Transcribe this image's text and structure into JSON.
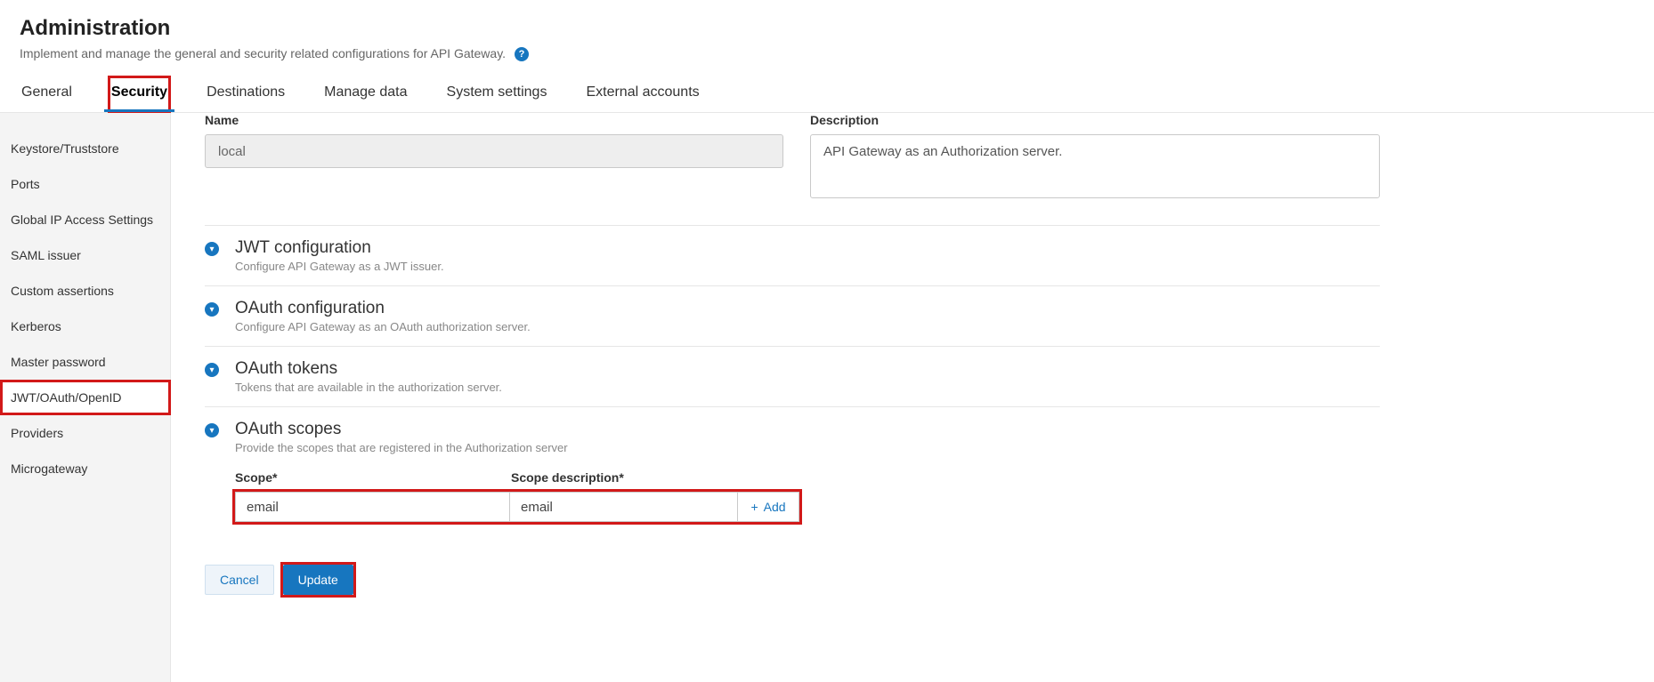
{
  "page": {
    "title": "Administration",
    "subtitle": "Implement and manage the general and security related configurations for API Gateway."
  },
  "tabs": [
    {
      "label": "General",
      "active": false
    },
    {
      "label": "Security",
      "active": true
    },
    {
      "label": "Destinations",
      "active": false
    },
    {
      "label": "Manage data",
      "active": false
    },
    {
      "label": "System settings",
      "active": false
    },
    {
      "label": "External accounts",
      "active": false
    }
  ],
  "sidebar": {
    "items": [
      {
        "label": "Keystore/Truststore",
        "active": false
      },
      {
        "label": "Ports",
        "active": false
      },
      {
        "label": "Global IP Access Settings",
        "active": false
      },
      {
        "label": "SAML issuer",
        "active": false
      },
      {
        "label": "Custom assertions",
        "active": false
      },
      {
        "label": "Kerberos",
        "active": false
      },
      {
        "label": "Master password",
        "active": false
      },
      {
        "label": "JWT/OAuth/OpenID",
        "active": true
      },
      {
        "label": "Providers",
        "active": false
      },
      {
        "label": "Microgateway",
        "active": false
      }
    ]
  },
  "form": {
    "name_label": "Name",
    "name_value": "local",
    "desc_label": "Description",
    "desc_value": "API Gateway as an Authorization server."
  },
  "accordions": [
    {
      "title": "JWT configuration",
      "subtitle": "Configure API Gateway as a JWT issuer.",
      "expanded": false
    },
    {
      "title": "OAuth configuration",
      "subtitle": "Configure API Gateway as an OAuth authorization server.",
      "expanded": false
    },
    {
      "title": "OAuth tokens",
      "subtitle": "Tokens that are available in the authorization server.",
      "expanded": false
    },
    {
      "title": "OAuth scopes",
      "subtitle": "Provide the scopes that are registered in the Authorization server",
      "expanded": true
    }
  ],
  "scopes": {
    "scope_label": "Scope*",
    "scope_desc_label": "Scope description*",
    "scope_value": "email",
    "scope_desc_value": "email",
    "add_label": "Add"
  },
  "buttons": {
    "cancel": "Cancel",
    "update": "Update"
  }
}
